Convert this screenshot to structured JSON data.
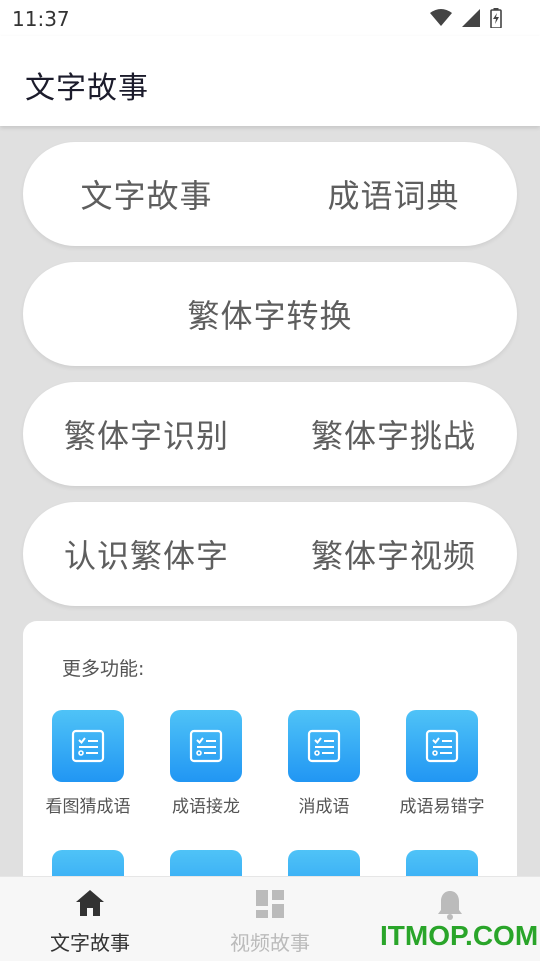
{
  "status_bar": {
    "time": "11:37"
  },
  "app_bar": {
    "title": "文字故事"
  },
  "rows": [
    {
      "left": "文字故事",
      "right": "成语词典"
    },
    {
      "center": "繁体字转换"
    },
    {
      "left": "繁体字识别",
      "right": "繁体字挑战"
    },
    {
      "left": "认识繁体字",
      "right": "繁体字视频"
    }
  ],
  "more": {
    "title": "更多功能:",
    "items": [
      {
        "label": "看图猜成语",
        "icon": "checklist-icon"
      },
      {
        "label": "成语接龙",
        "icon": "checklist-icon"
      },
      {
        "label": "消成语",
        "icon": "checklist-icon"
      },
      {
        "label": "成语易错字",
        "icon": "checklist-icon"
      }
    ]
  },
  "bottom_nav": [
    {
      "label": "文字故事",
      "icon": "home-icon",
      "active": true
    },
    {
      "label": "视频故事",
      "icon": "dashboard-icon",
      "active": false
    },
    {
      "label": "",
      "icon": "bell-icon",
      "active": false
    }
  ],
  "watermark": "ITMOP.COM",
  "colors": {
    "accent": "#2196f3",
    "tile_top": "#4fc3f7",
    "watermark": "#2aa52a"
  }
}
